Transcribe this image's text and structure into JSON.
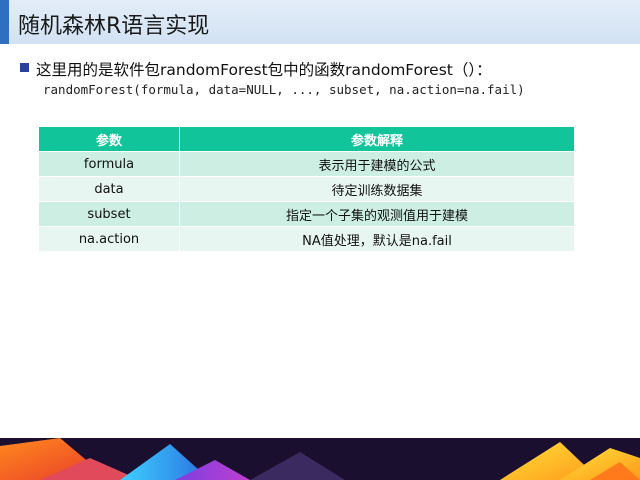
{
  "slide": {
    "title": "随机森林R语言实现",
    "bullet_text": "这里用的是软件包randomForest包中的函数randomForest（）：",
    "code_line": "randomForest(formula, data=NULL, ..., subset, na.action=na.fail)"
  },
  "table": {
    "headers": [
      "参数",
      "参数解释"
    ],
    "rows": [
      [
        "formula",
        "表示用于建模的公式"
      ],
      [
        "data",
        "待定训练数据集"
      ],
      [
        "subset",
        "指定一个子集的观测值用于建模"
      ],
      [
        "na.action",
        "NA值处理，默认是na.fail"
      ]
    ]
  },
  "colors": {
    "title_accent": "#2f6fc0",
    "header_bg": "#12c49a",
    "row_odd": "#cdeee3",
    "row_even": "#e8f6f1"
  }
}
